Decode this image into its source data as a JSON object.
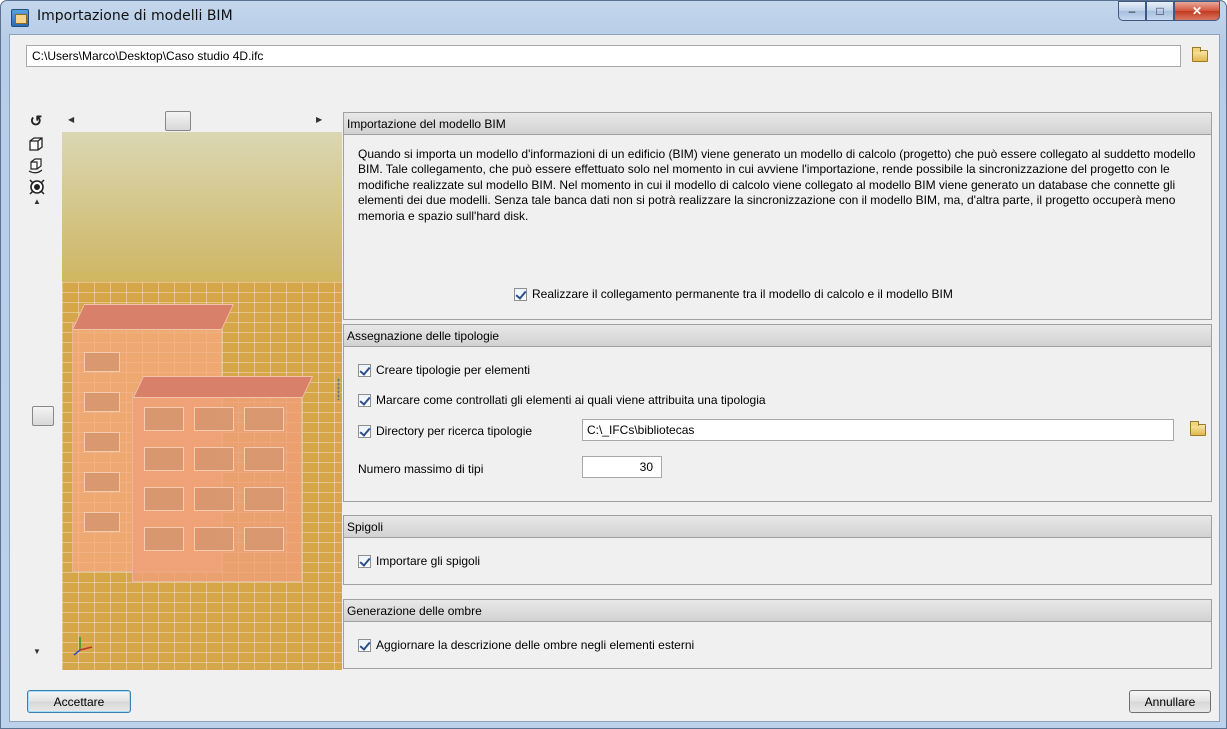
{
  "window": {
    "title": "Importazione di modelli BIM",
    "icon": "app-icon",
    "controls": {
      "minimize": "–",
      "maximize": "□",
      "close": "✕"
    }
  },
  "path": {
    "value": "C:\\Users\\Marco\\Desktop\\Caso studio 4D.ifc",
    "browse_icon": "folder-open-icon"
  },
  "toolbar": {
    "icons": [
      "rotate-icon",
      "cube-icon",
      "orbit-icon",
      "visibility-icon"
    ]
  },
  "sections": {
    "import": {
      "header": "Importazione del modello BIM",
      "description": "Quando si importa un modello d'informazioni di un edificio (BIM) viene generato un modello di calcolo (progetto) che può essere collegato al suddetto modello BIM. Tale collegamento, che può essere effettuato solo nel momento in cui avviene l'importazione, rende possibile la sincronizzazione del progetto con le modifiche realizzate sul modello BIM. Nel momento in cui il modello di calcolo viene collegato al modello BIM viene generato un database che connette gli elementi dei due modelli. Senza tale banca dati non si potrà realizzare la sincronizzazione con il modello BIM, ma, d'altra parte, il progetto occuperà meno memoria e spazio sull'hard disk.",
      "link_checkbox": "Realizzare il collegamento permanente tra il modello di calcolo e il modello BIM"
    },
    "types": {
      "header": "Assegnazione delle tipologie",
      "create_types": "Creare tipologie per elementi",
      "mark_controlled": "Marcare come controllati gli elementi ai quali viene attribuita una tipologia",
      "directory_label": "Directory per ricerca tipologie",
      "directory_value": "C:\\_IFCs\\bibliotecas",
      "max_label": "Numero massimo di tipi",
      "max_value": "30"
    },
    "edges": {
      "header": "Spigoli",
      "import_edges": "Importare gli spigoli"
    },
    "shadows": {
      "header": "Generazione delle ombre",
      "update_shadows": "Aggiornare la descrizione delle ombre negli elementi esterni"
    }
  },
  "footer": {
    "accept": "Accettare",
    "cancel": "Annullare"
  }
}
